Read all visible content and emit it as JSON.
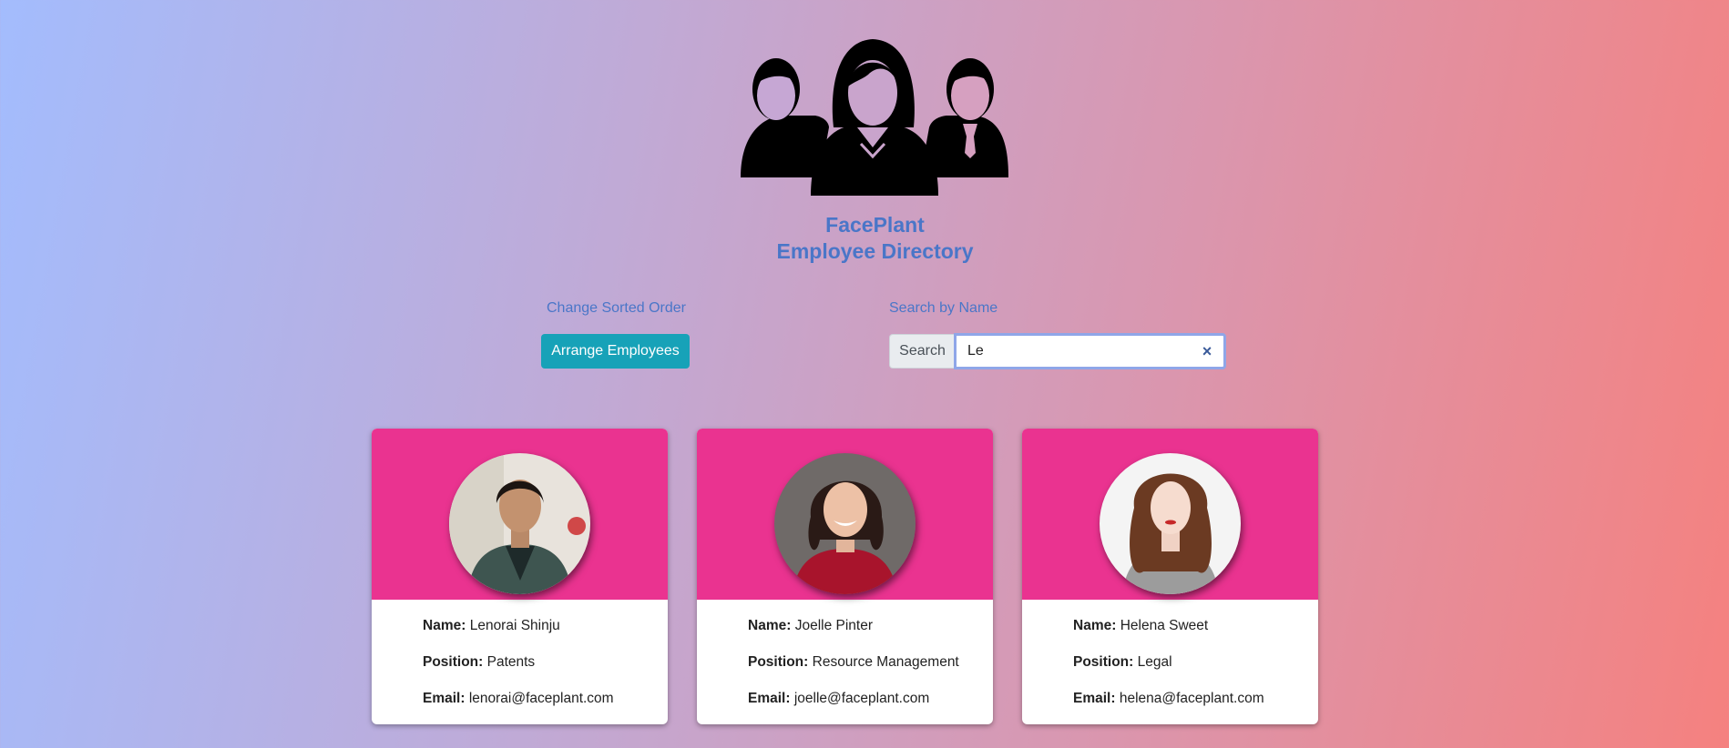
{
  "header": {
    "brand": "FacePlant",
    "subtitle": "Employee Directory"
  },
  "controls": {
    "sort_label": "Change Sorted Order",
    "sort_button": "Arrange Employees",
    "search_label": "Search by Name",
    "search_prefix": "Search",
    "search_value": "Le",
    "clear_icon": "×"
  },
  "card_labels": {
    "name": "Name:",
    "position": "Position:",
    "email": "Email:"
  },
  "employees": [
    {
      "name": "Lenorai Shinju",
      "position": "Patents",
      "email": "lenorai@faceplant.com"
    },
    {
      "name": "Joelle Pinter",
      "position": "Resource Management",
      "email": "joelle@faceplant.com"
    },
    {
      "name": "Helena Sweet",
      "position": "Legal",
      "email": "helena@faceplant.com"
    }
  ],
  "colors": {
    "accent": "#4a76c8",
    "button": "#17a2b8",
    "card_header": "#ea3390"
  }
}
